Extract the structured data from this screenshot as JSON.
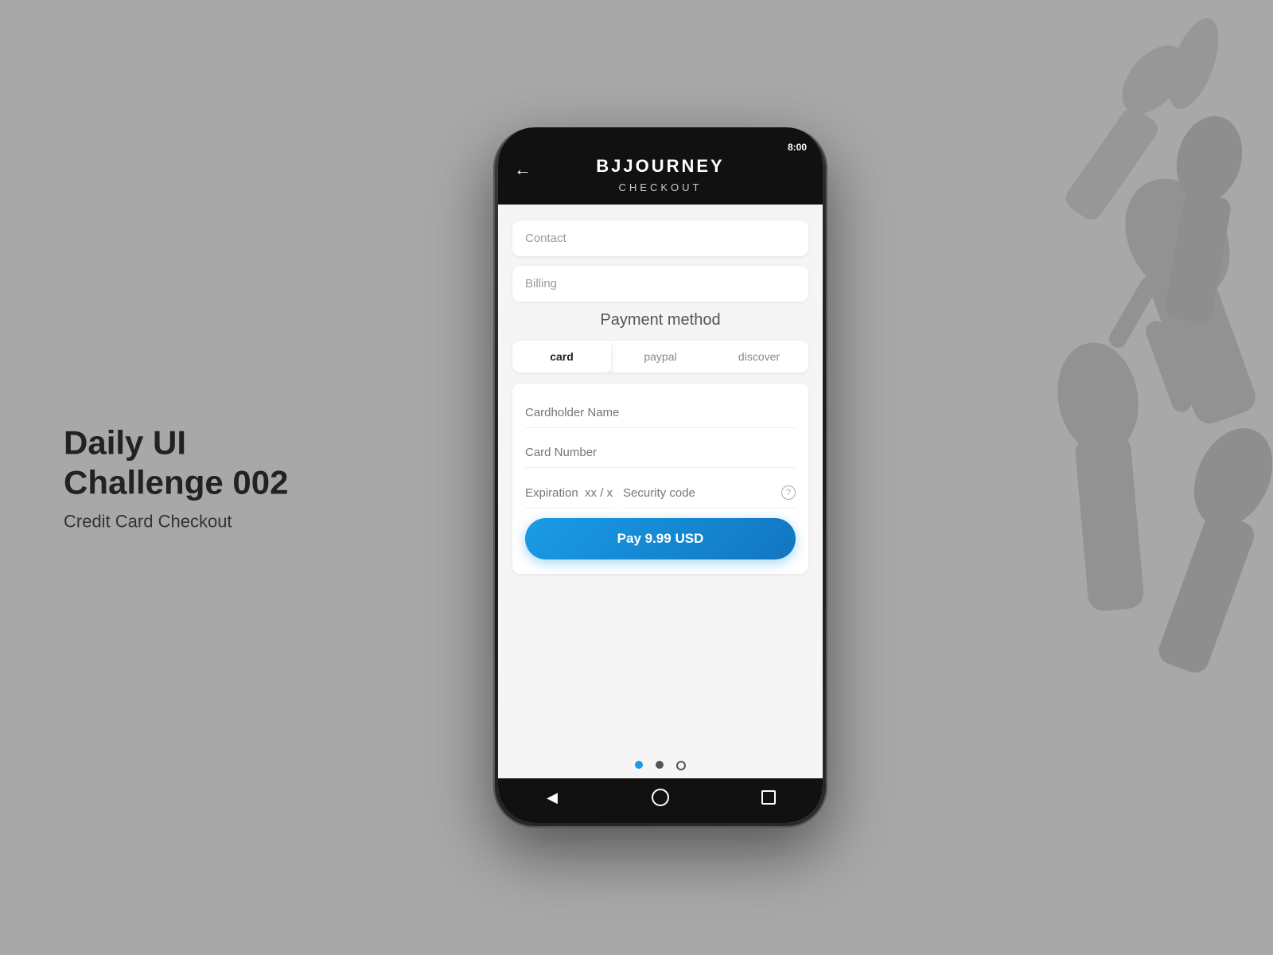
{
  "page": {
    "background_color": "#a8a8a8"
  },
  "left_panel": {
    "challenge_title": "Daily UI Challenge 002",
    "challenge_subtitle": "Credit Card Checkout"
  },
  "phone": {
    "status_bar": {
      "time": "8:00"
    },
    "header": {
      "back_label": "←",
      "logo": "BJJOURNEY",
      "subtitle": "CHECKOUT"
    },
    "content": {
      "contact_placeholder": "Contact",
      "billing_placeholder": "Billing",
      "payment_method_title": "Payment method",
      "tabs": [
        {
          "label": "card",
          "active": true
        },
        {
          "label": "paypal",
          "active": false
        },
        {
          "label": "discover",
          "active": false
        }
      ],
      "card_form": {
        "cardholder_name_placeholder": "Cardholder Name",
        "card_number_placeholder": "Card Number",
        "expiration_placeholder": "Expiration  xx / xx",
        "security_code_placeholder": "Security code"
      },
      "pay_button_label": "Pay 9.99 USD"
    },
    "pagination": {
      "dots": [
        "filled-blue",
        "filled-dark",
        "outline"
      ]
    },
    "nav": {
      "back_icon": "◀",
      "home_icon": "circle",
      "square_icon": "square"
    }
  }
}
